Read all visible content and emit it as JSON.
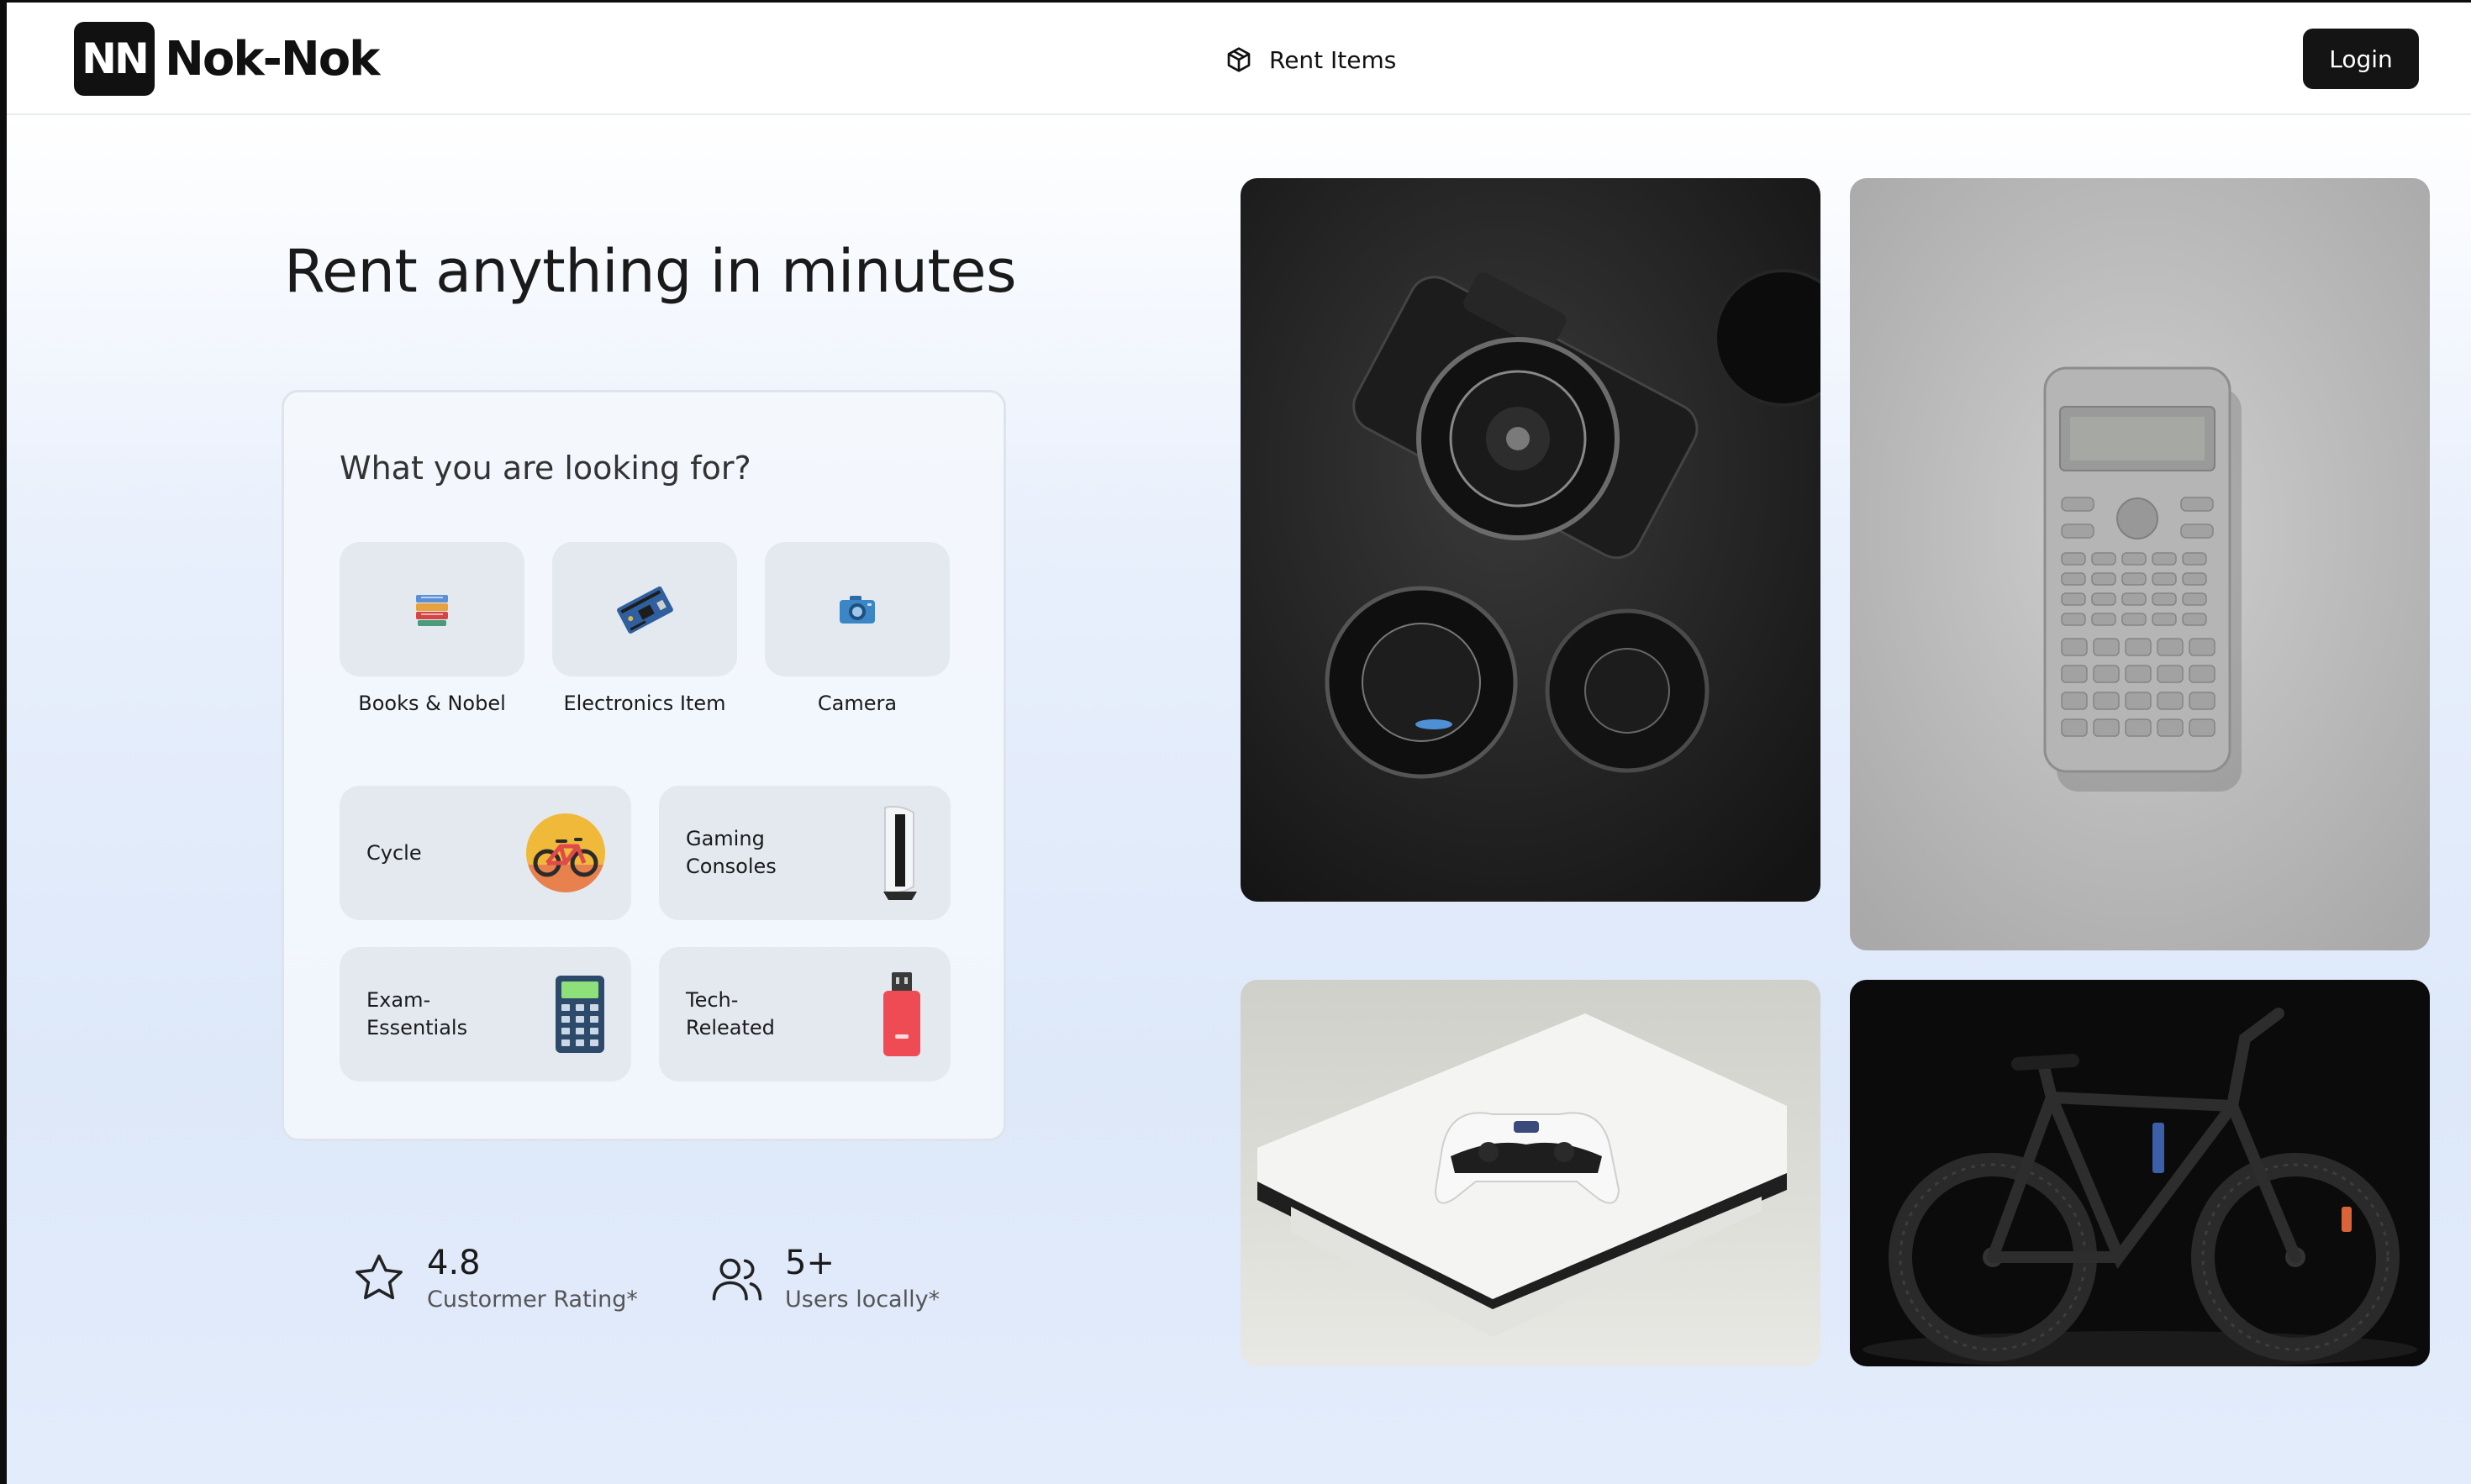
{
  "header": {
    "logo_mark": "NN",
    "logo_text": "Nok-Nok",
    "nav_rent_label": "Rent Items",
    "login_label": "Login"
  },
  "hero": {
    "title": "Rent anything in minutes"
  },
  "search_card": {
    "title": "What you are looking for?",
    "categories": [
      {
        "label": "Books & Nobel",
        "icon": "books-icon"
      },
      {
        "label": "Electronics Item",
        "icon": "circuit-board-icon"
      },
      {
        "label": "Camera",
        "icon": "camera-icon"
      }
    ],
    "tiles": [
      {
        "label": "Cycle",
        "icon": "bicycle-icon"
      },
      {
        "label": "Gaming Consoles",
        "icon": "game-console-icon"
      },
      {
        "label": "Exam-Essentials",
        "icon": "calculator-icon"
      },
      {
        "label": "Tech-Releated",
        "icon": "usb-drive-icon"
      }
    ]
  },
  "stats": [
    {
      "value": "4.8",
      "label": "Custormer Rating*",
      "icon": "star-icon"
    },
    {
      "value": "5+",
      "label": "Users locally*",
      "icon": "users-icon"
    }
  ],
  "gallery": [
    {
      "subject": "camera-photo"
    },
    {
      "subject": "calculator-photo"
    },
    {
      "subject": "game-console-photo"
    },
    {
      "subject": "bicycle-photo"
    }
  ],
  "colors": {
    "accent": "#141414",
    "tile_bg": "#e4e9f0",
    "page_gradient_bottom": "#dde8f9"
  }
}
